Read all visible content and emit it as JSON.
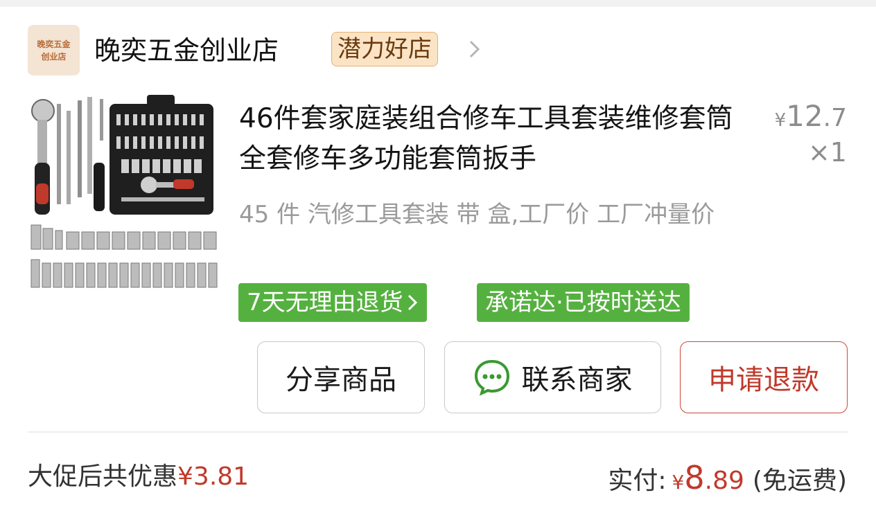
{
  "store": {
    "logo_line1": "晚奕五金",
    "logo_line2": "创业店",
    "name": "晚奕五金创业店",
    "badge": "潜力好店"
  },
  "product": {
    "title": "46件套家庭装组合修车工具套装维修套筒全套修车多功能套筒扳手",
    "spec": "45 件 汽修工具套装 带 盒,工厂价 工厂冲量价",
    "price_symbol": "¥",
    "price_int": "12",
    "price_dec": ".7",
    "quantity": "×1",
    "tags": [
      {
        "label": "7天无理由退货"
      },
      {
        "label": "承诺达·已按时送达"
      }
    ]
  },
  "actions": {
    "share": "分享商品",
    "contact": "联系商家",
    "refund": "申请退款"
  },
  "footer": {
    "promo_label": "大促后共优惠",
    "promo_amount": "¥3.81",
    "paid_label": "实付:",
    "paid_symbol": "¥",
    "paid_int": "8",
    "paid_dec": ".89",
    "shipping": "(免运费)"
  },
  "colors": {
    "accent_red": "#c0392b",
    "tag_green": "#55b13f",
    "badge_bg": "#fbe4c5"
  },
  "icons": [
    "chevron-right-icon",
    "chat-bubble-icon",
    "product-thumbnail"
  ]
}
